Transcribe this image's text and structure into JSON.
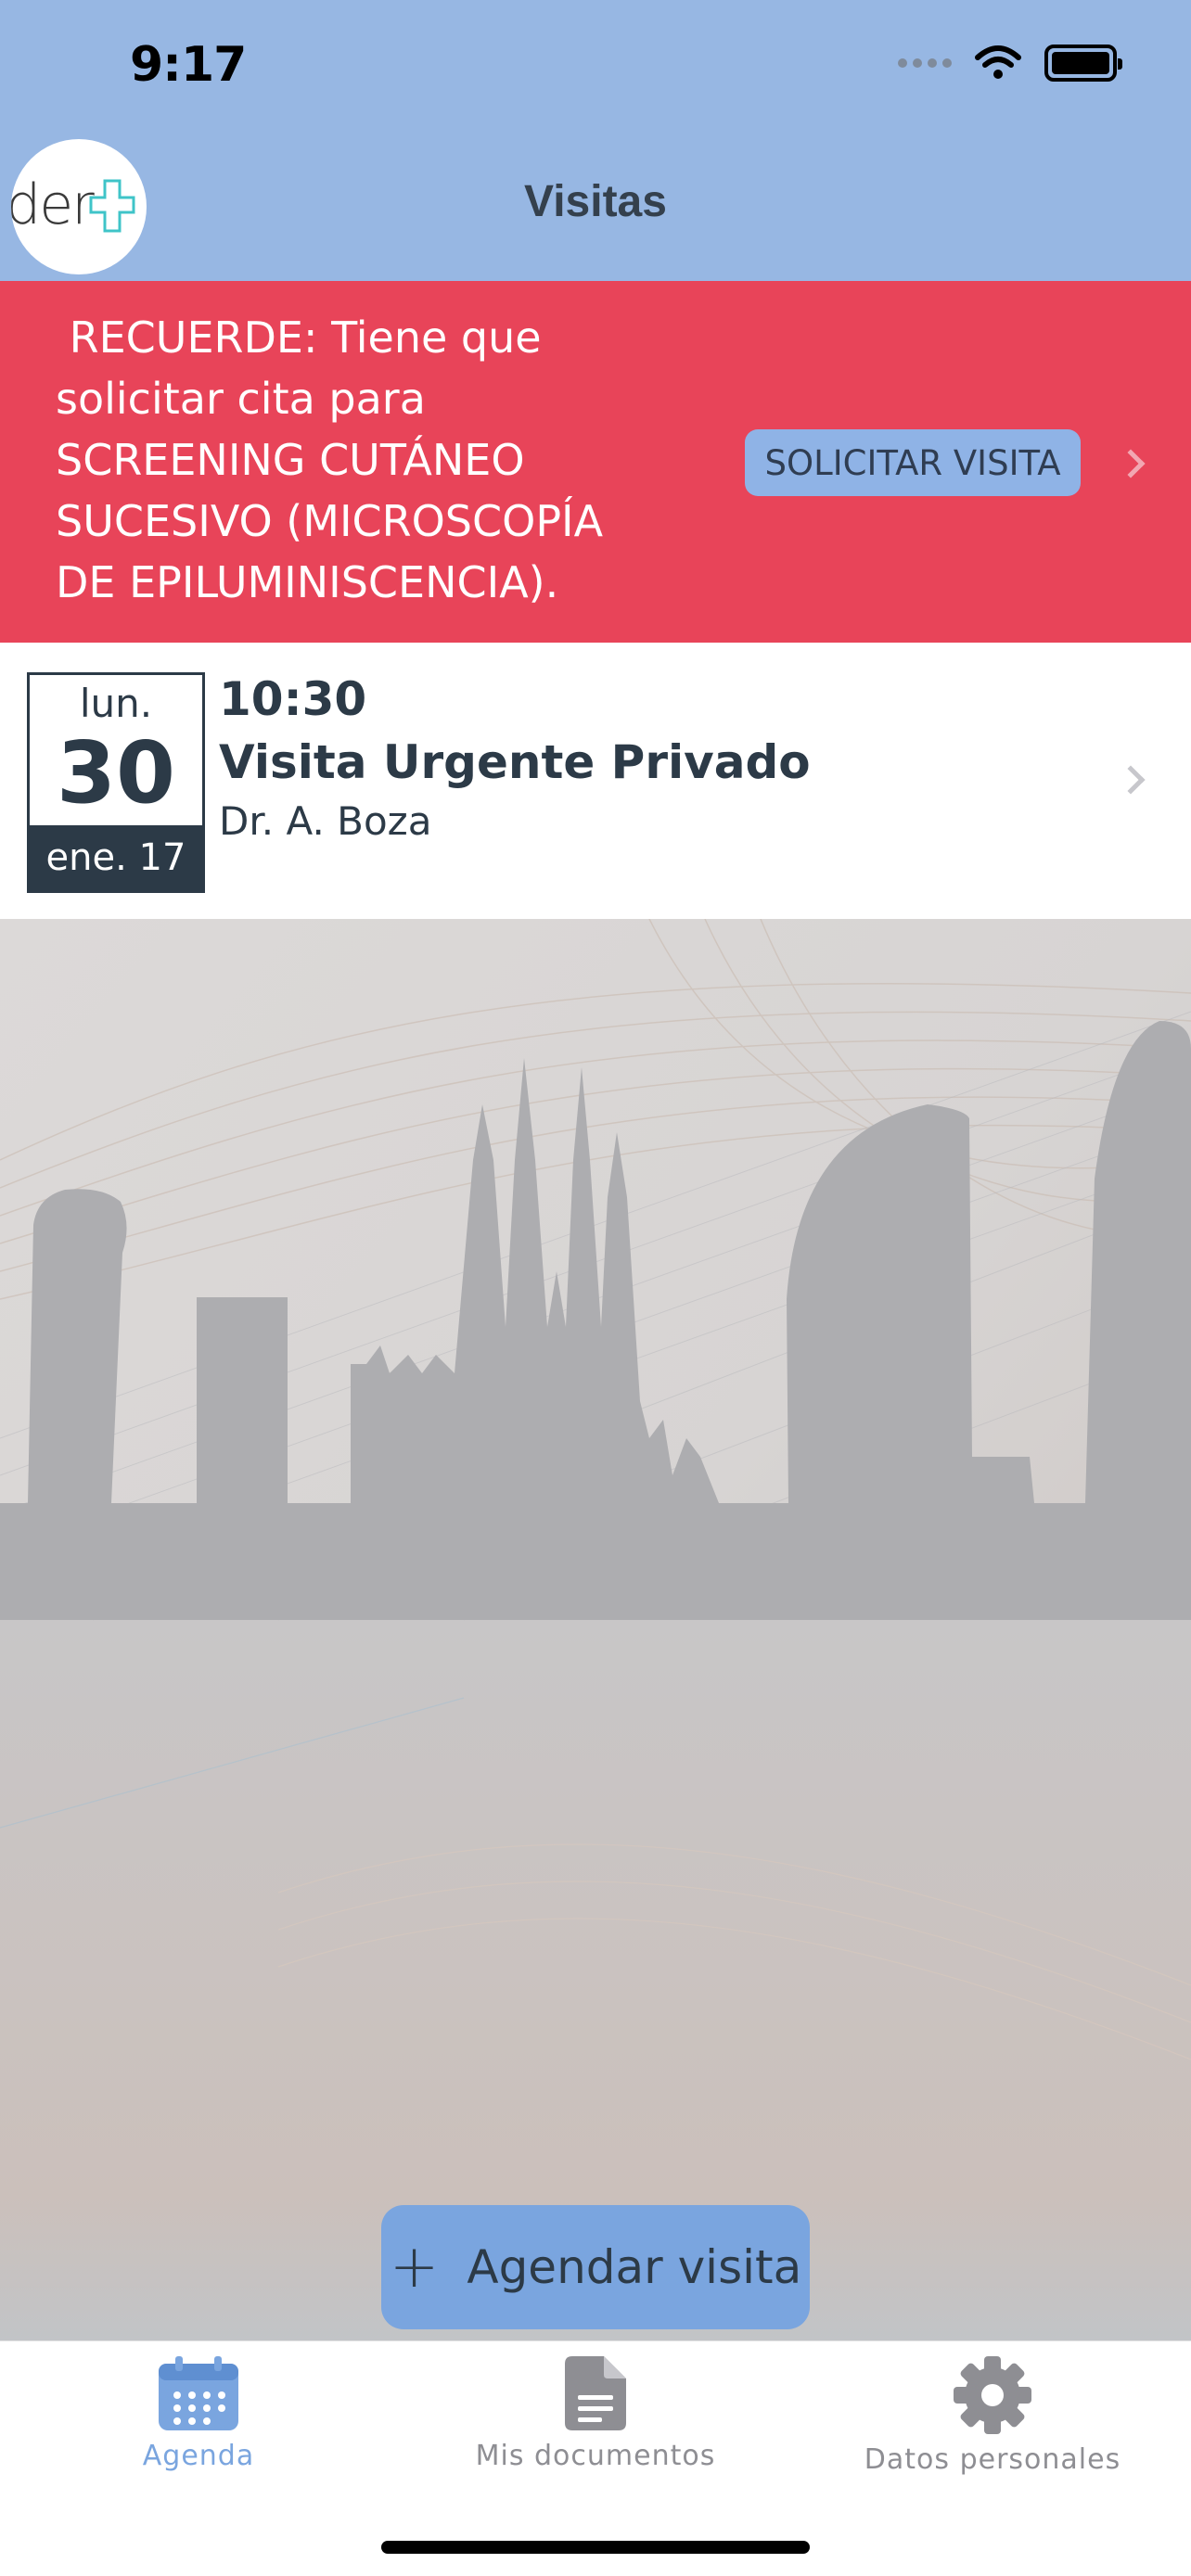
{
  "status_bar": {
    "time": "9:17"
  },
  "header": {
    "title": "Visitas",
    "logo_text": "der"
  },
  "reminder": {
    "text": " RECUERDE: Tiene que solicitar cita para SCREENING CUTÁNEO SUCESIVO (MICROSCOPÍA DE EPILUMINISCENCIA).",
    "button_label": "SOLICITAR VISITA"
  },
  "visit": {
    "weekday": "lun.",
    "day": "30",
    "month_year": "ene. 17",
    "time": "10:30",
    "type": "Visita Urgente Privado",
    "doctor": "Dr. A. Boza"
  },
  "fab": {
    "label": "Agendar visita"
  },
  "tabs": [
    {
      "label": "Agenda",
      "icon": "calendar-icon",
      "active": true
    },
    {
      "label": "Mis documentos",
      "icon": "document-icon",
      "active": false
    },
    {
      "label": "Datos personales",
      "icon": "gear-icon",
      "active": false
    }
  ],
  "colors": {
    "header": "#97b7e3",
    "reminder": "#e84459",
    "accent": "#7aa5df",
    "text_dark": "#2c3a47"
  }
}
